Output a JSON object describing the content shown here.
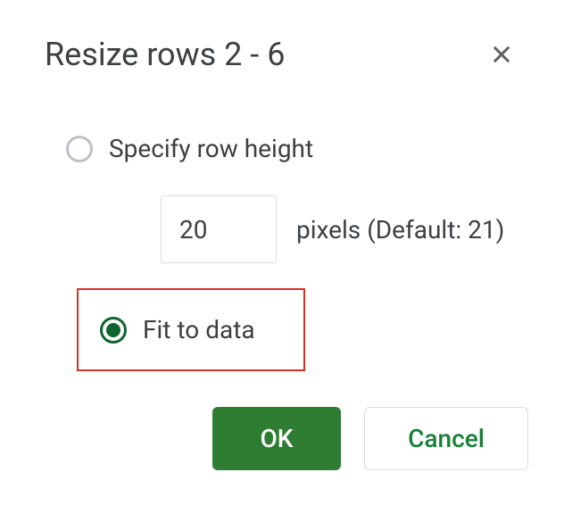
{
  "dialog": {
    "title": "Resize rows 2 - 6",
    "options": {
      "specify": {
        "label": "Specify row height",
        "selected": false
      },
      "fit": {
        "label": "Fit to data",
        "selected": true
      }
    },
    "input": {
      "value": "20",
      "suffix": "pixels (Default: 21)"
    },
    "buttons": {
      "ok": "OK",
      "cancel": "Cancel"
    }
  }
}
